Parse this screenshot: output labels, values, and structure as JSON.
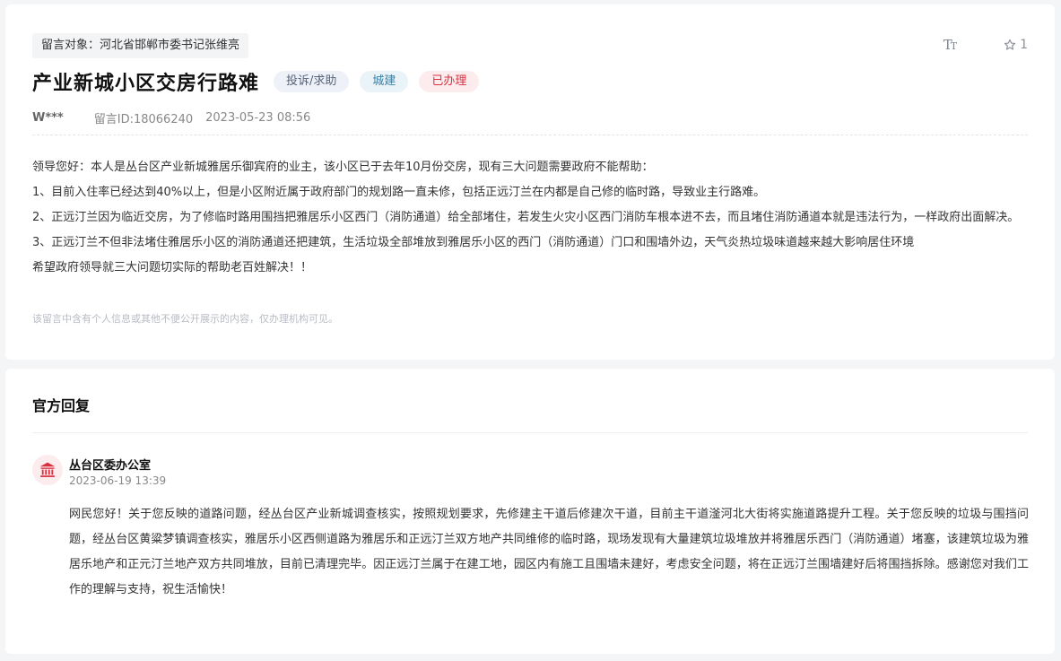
{
  "message": {
    "target_label": "留言对象：河北省邯郸市委书记张维亮",
    "title": "产业新城小区交房行路难",
    "tags": {
      "type": "投诉/求助",
      "field": "城建",
      "status": "已办理"
    },
    "author": "W***",
    "message_id": "留言ID:18066240",
    "date": "2023-05-23 08:56",
    "font_size_icon": "font-size-icon",
    "favorite_count": "1",
    "paragraphs": [
      "领导您好：本人是丛台区产业新城雅居乐御宾府的业主，该小区已于去年10月份交房，现有三大问题需要政府不能帮助：",
      "1、目前入住率已经达到40%以上，但是小区附近属于政府部门的规划路一直未修，包括正远汀兰在内都是自己修的临时路，导致业主行路难。",
      "2、正远汀兰因为临近交房，为了修临时路用围挡把雅居乐小区西门（消防通道）给全部堵住，若发生火灾小区西门消防车根本进不去，而且堵住消防通道本就是违法行为，一样政府出面解决。",
      "3、正远汀兰不但非法堵住雅居乐小区的消防通道还把建筑，生活垃圾全部堆放到雅居乐小区的西门（消防通道）门口和围墙外边，天气炎热垃圾味道越来越大影响居住环境",
      "希望政府领导就三大问题切实际的帮助老百姓解决！！"
    ],
    "notice": "该留言中含有个人信息或其他不便公开展示的内容，仅办理机构可见。"
  },
  "reply": {
    "section_title": "官方回复",
    "org_name": "丛台区委办公室",
    "time": "2023-06-19 13:39",
    "content": "网民您好！关于您反映的道路问题，经丛台区产业新城调查核实，按照规划要求，先修建主干道后修建次干道，目前主干道滏河北大街将实施道路提升工程。关于您反映的垃圾与围挡问题，经丛台区黄粱梦镇调查核实，雅居乐小区西侧道路为雅居乐和正远汀兰双方地产共同维修的临时路，现场发现有大量建筑垃圾堆放并将雅居乐西门（消防通道）堵塞，该建筑垃圾为雅居乐地产和正元汀兰地产双方共同堆放，目前已清理完毕。因正远汀兰属于在建工地，园区内有施工且围墙未建好，考虑安全问题，将在正远汀兰围墙建好后将围挡拆除。感谢您对我们工作的理解与支持，祝生活愉快！"
  },
  "colors": {
    "status_red": "#d9303f",
    "field_blue": "#3b7fa6",
    "page_bg": "#f4f5f7"
  }
}
